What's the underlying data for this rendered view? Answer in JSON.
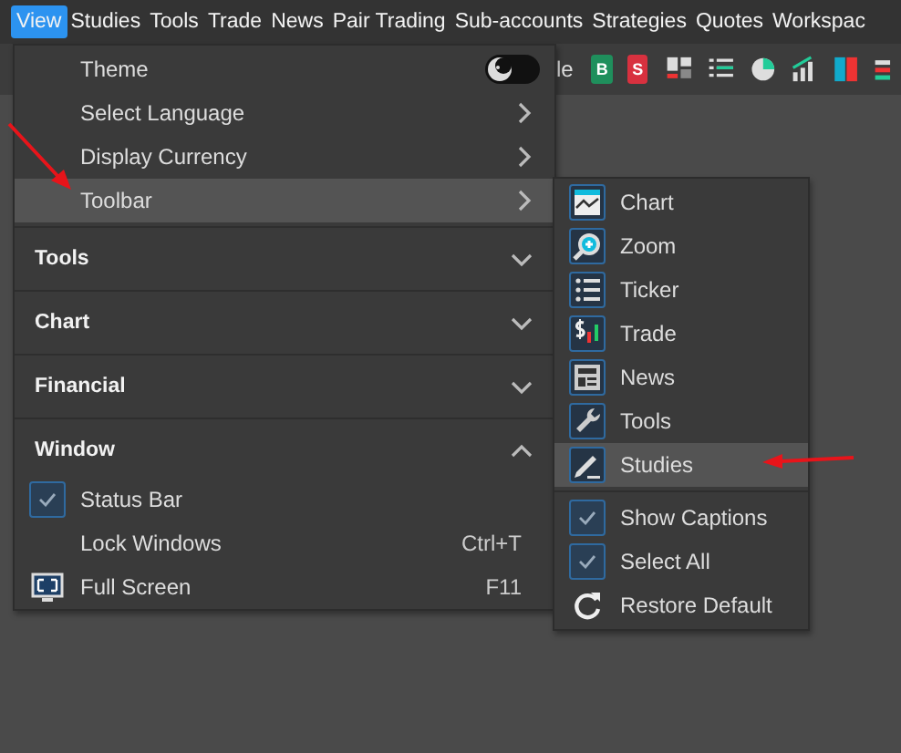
{
  "menubar": [
    {
      "label": "View",
      "selected": true
    },
    {
      "label": "Studies",
      "selected": false
    },
    {
      "label": "Tools",
      "selected": false
    },
    {
      "label": "Trade",
      "selected": false
    },
    {
      "label": "News",
      "selected": false
    },
    {
      "label": "Pair Trading",
      "selected": false
    },
    {
      "label": "Sub-accounts",
      "selected": false
    },
    {
      "label": "Strategies",
      "selected": false
    },
    {
      "label": "Quotes",
      "selected": false
    },
    {
      "label": "Workspac",
      "selected": false
    }
  ],
  "toolbar": {
    "partial_label": "le",
    "buttons": [
      {
        "label": "B",
        "color": "#1f8f5c"
      },
      {
        "label": "S",
        "color": "#d8313f"
      }
    ]
  },
  "view_menu": {
    "items": [
      {
        "kind": "toggle",
        "label": "Theme",
        "on": false,
        "selected": false
      },
      {
        "kind": "submenu",
        "label": "Select Language",
        "selected": false
      },
      {
        "kind": "submenu",
        "label": "Display Currency",
        "selected": false
      },
      {
        "kind": "submenu",
        "label": "Toolbar",
        "selected": true
      },
      {
        "kind": "section",
        "label": "Tools",
        "expanded": false,
        "selected": false
      },
      {
        "kind": "section",
        "label": "Chart",
        "expanded": false,
        "selected": false
      },
      {
        "kind": "section",
        "label": "Financial",
        "expanded": false,
        "selected": false
      },
      {
        "kind": "section",
        "label": "Window",
        "expanded": true,
        "selected": false
      },
      {
        "kind": "check",
        "label": "Status Bar",
        "checked": true,
        "selected": false
      },
      {
        "kind": "action",
        "label": "Lock Windows",
        "shortcut": "Ctrl+T",
        "selected": false
      },
      {
        "kind": "action",
        "label": "Full Screen",
        "shortcut": "F11",
        "selected": false
      }
    ]
  },
  "toolbar_submenu": {
    "items": [
      {
        "kind": "tool",
        "label": "Chart",
        "selected": false
      },
      {
        "kind": "tool",
        "label": "Zoom",
        "selected": false
      },
      {
        "kind": "tool",
        "label": "Ticker",
        "selected": false
      },
      {
        "kind": "tool",
        "label": "Trade",
        "selected": false
      },
      {
        "kind": "tool",
        "label": "News",
        "selected": false
      },
      {
        "kind": "tool",
        "label": "Tools",
        "selected": false
      },
      {
        "kind": "tool",
        "label": "Studies",
        "selected": true
      },
      {
        "kind": "check",
        "label": "Show Captions",
        "checked": true,
        "selected": false
      },
      {
        "kind": "check",
        "label": "Select All",
        "checked": true,
        "selected": false
      },
      {
        "kind": "action",
        "label": "Restore Default",
        "selected": false
      }
    ]
  }
}
